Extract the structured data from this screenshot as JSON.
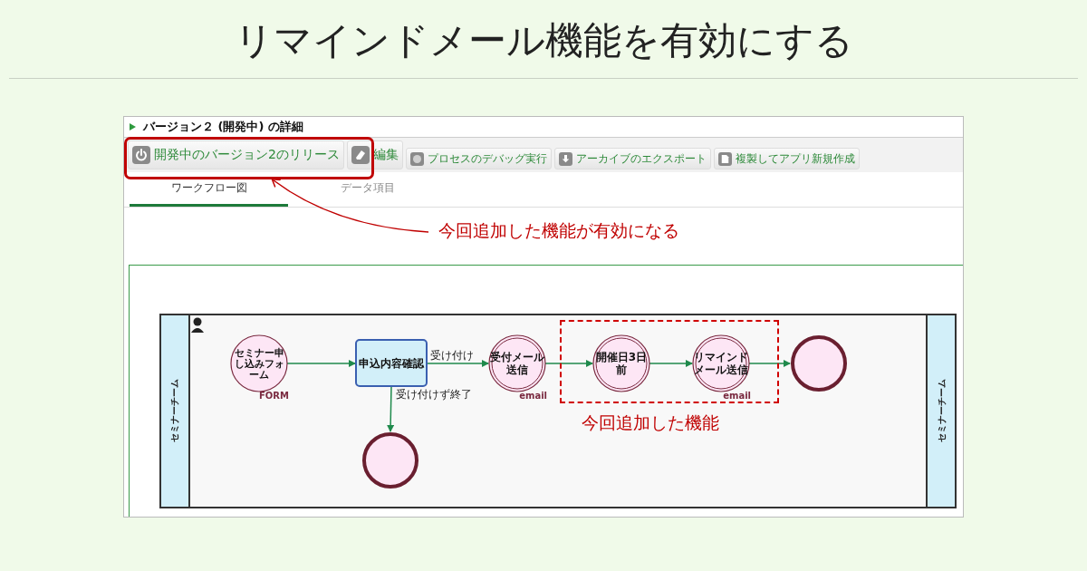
{
  "heading": "リマインドメール機能を有効にする",
  "screen": {
    "title": "バージョン２ (開発中) の詳細",
    "toolbar": [
      {
        "label": "開発中のバージョン2のリリース",
        "kind": "large"
      },
      {
        "label": "編集",
        "kind": "large"
      },
      {
        "label": "プロセスのデバッグ実行",
        "kind": "small"
      },
      {
        "label": "アーカイブのエクスポート",
        "kind": "small"
      },
      {
        "label": "複製してアプリ新規作成",
        "kind": "small"
      }
    ],
    "tabs": [
      {
        "label": "ワークフロー図",
        "selected": true
      },
      {
        "label": "データ項目",
        "selected": false
      }
    ],
    "diagram": {
      "lanes": [
        "セミナーチーム",
        "セミナーチーム"
      ],
      "nodes": [
        {
          "kind": "form",
          "lines": [
            "セミナー申",
            "し込みフォ",
            "ーム"
          ],
          "tag": "FORM"
        },
        {
          "kind": "task",
          "lines": [
            "申込内容確認"
          ]
        },
        {
          "kind": "email",
          "lines": [
            "受付メール",
            "送信"
          ],
          "tag": "email"
        },
        {
          "kind": "timer",
          "lines": [
            "開催日3日",
            "前"
          ]
        },
        {
          "kind": "email",
          "lines": [
            "リマインド",
            "メール送信"
          ],
          "tag": "email"
        },
        {
          "kind": "end"
        },
        {
          "kind": "end"
        }
      ],
      "flow_labels": [
        "受け付け",
        "受け付けず終了"
      ]
    }
  },
  "callouts": [
    {
      "kind": "arrow",
      "text": "今回追加した機能が有効になる"
    },
    {
      "kind": "box",
      "text": "今回追加した機能"
    }
  ]
}
